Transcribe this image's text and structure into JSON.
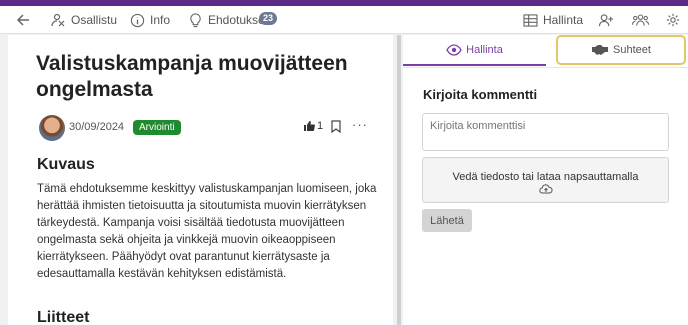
{
  "topbar": {
    "nav": [
      {
        "label": "Osallistu",
        "icon": "participate-icon"
      },
      {
        "label": "Info",
        "icon": "info-icon"
      },
      {
        "label": "Ehdotukset",
        "icon": "lightbulb-icon"
      }
    ],
    "proposals_count": "23",
    "hallinta_label": "Hallinta",
    "icons": [
      "back-arrow-icon",
      "table-icon",
      "add-user-icon",
      "group-icon",
      "gear-icon"
    ]
  },
  "proposal": {
    "title": "Valistuskampanja muovijätteen ongelmasta",
    "date": "30/09/2024",
    "status": "Arviointi",
    "likes": "1",
    "description_heading": "Kuvaus",
    "description": "Tämä ehdotuksemme keskittyy valistuskampanjan luomiseen, joka herättää ihmisten tietoisuutta ja sitoutumista muovin kierrätyksen tärkeydestä. Kampanja voisi sisältää tiedotusta muovijätteen ongelmasta sekä ohjeita ja vinkkejä muovin oikeaoppiseen kierrätykseen. Päähyödyt ovat parantunut kierrätysaste ja edesauttamalla kestävän kehityksen edistämistä.",
    "attachments_heading": "Liitteet"
  },
  "panel": {
    "tabs": [
      {
        "label": "Hallinta",
        "icon": "eye-icon"
      },
      {
        "label": "Suhteet",
        "icon": "handshake-icon"
      }
    ],
    "comment_heading": "Kirjoita kommentti",
    "comment_placeholder": "Kirjoita kommenttisi",
    "upload_text": "Vedä tiedosto tai lataa napsauttamalla",
    "send_label": "Lähetä"
  },
  "colors": {
    "brand": "#5b2a86",
    "status": "#1f8a2e",
    "highlight": "#e3c667"
  }
}
